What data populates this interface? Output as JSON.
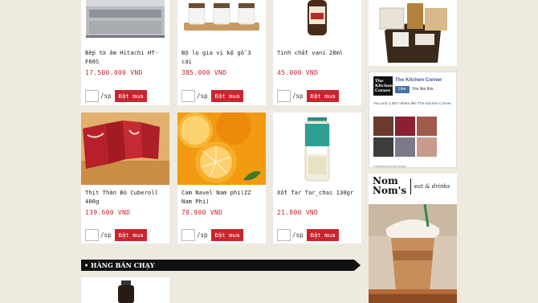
{
  "products_row1": [
    {
      "name": "Bếp từ âm Hitachi HT-F60S",
      "price": "17.500.000 VND",
      "unit": "/sp",
      "buy": "Đặt mua"
    },
    {
      "name": "Bộ lọ gia vị kệ gỗ 3 cái",
      "price": "385.000 VND",
      "unit": "/sp",
      "buy": "Đặt mua"
    },
    {
      "name": "Tinh chất vani 28ml",
      "price": "45.000 VND",
      "unit": "/sp",
      "buy": "Đặt mua"
    }
  ],
  "products_row2": [
    {
      "name": "Thịt Thăn Bò Cuberoll 400g",
      "price": "139.600 VND",
      "unit": "/sp",
      "buy": "Đặt mua"
    },
    {
      "name": "Cam Navel Nam phi(ZZ Nam Phi)",
      "price": "79.900 VND",
      "unit": "/sp",
      "buy": "Đặt mua"
    },
    {
      "name": "Xốt Tar Tar_chai 130gr",
      "price": "21.800 VND",
      "unit": "/sp",
      "buy": "Đặt mua"
    }
  ],
  "section": {
    "title": "• HÀNG BÁN CHẠY"
  },
  "facebook": {
    "logo_text": "The Kitchen Corner",
    "page_name": "The Kitchen Corner",
    "like_label": "Like",
    "like_this": "You like this.",
    "others_prefix": "You and 1,067 others like ",
    "others_link": "The Kitchen Corner",
    "others_suffix": ".",
    "plugin_label": "Facebook social plugin"
  },
  "ad": {
    "brand_line1": "Nom",
    "brand_line2": "Nom's",
    "tagline": "eat & drinks"
  },
  "colors": {
    "accent": "#c8262f",
    "background": "#efeae0",
    "facebook": "#3b5998"
  }
}
